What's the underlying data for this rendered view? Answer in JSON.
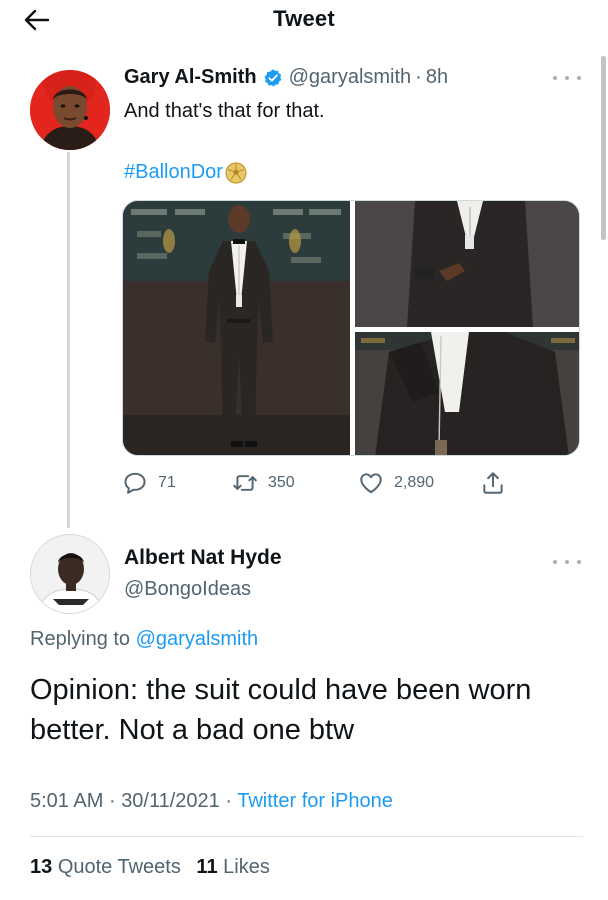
{
  "header": {
    "title": "Tweet",
    "back_icon": "arrow-left-icon"
  },
  "tweet": {
    "author_name": "Gary Al-Smith",
    "author_handle": "@garyalsmith",
    "separator": "·",
    "time": "8h",
    "text": "And that's that for that.",
    "hashtag": "#BallonDor",
    "hashtag_emoji": "ballon-dor-ball-icon",
    "counts": {
      "replies": "71",
      "retweets": "350",
      "likes": "2,890"
    }
  },
  "reply": {
    "author_name": "Albert Nat Hyde",
    "author_handle": "@BongoIdeas",
    "replying_prefix": "Replying to",
    "replying_to": "@garyalsmith",
    "text": "Opinion: the suit could have been worn better. Not a bad one btw",
    "time": "5:01 AM",
    "date": "30/11/2021",
    "source": "Twitter for iPhone",
    "quote_tweets_count": "13",
    "quote_tweets_label": "Quote Tweets",
    "likes_count": "11",
    "likes_label": "Likes"
  },
  "colors": {
    "accent": "#1d9bf0",
    "text": "#0f1419",
    "muted": "#536471",
    "divider": "#cfd9de"
  }
}
